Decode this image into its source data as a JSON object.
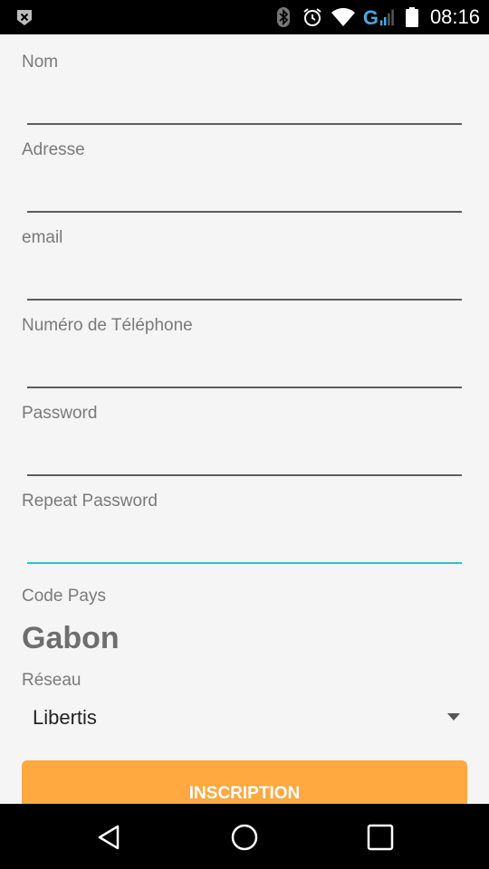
{
  "status_bar": {
    "time": "08:16",
    "icons": [
      "notification-close-icon",
      "bluetooth-icon",
      "alarm-icon",
      "wifi-icon",
      "network-g-icon",
      "signal-icon",
      "battery-icon"
    ],
    "network_type": "G"
  },
  "form": {
    "fields": [
      {
        "label": "Nom",
        "value": ""
      },
      {
        "label": "Adresse",
        "value": ""
      },
      {
        "label": "email",
        "value": ""
      },
      {
        "label": "Numéro de Téléphone",
        "value": ""
      },
      {
        "label": "Password",
        "value": ""
      },
      {
        "label": "Repeat Password",
        "value": "",
        "focused": true
      }
    ],
    "country": {
      "label": "Code Pays",
      "value": "Gabon"
    },
    "network": {
      "label": "Réseau",
      "value": "Libertis"
    },
    "submit_label": "INSCRIPTION"
  },
  "nav_bar": {
    "buttons": [
      "back-icon",
      "home-icon",
      "recents-icon"
    ]
  },
  "colors": {
    "accent": "#26c6c6",
    "button": "#ffa940",
    "label": "#7a7a7a",
    "status_bar": "#000000"
  }
}
